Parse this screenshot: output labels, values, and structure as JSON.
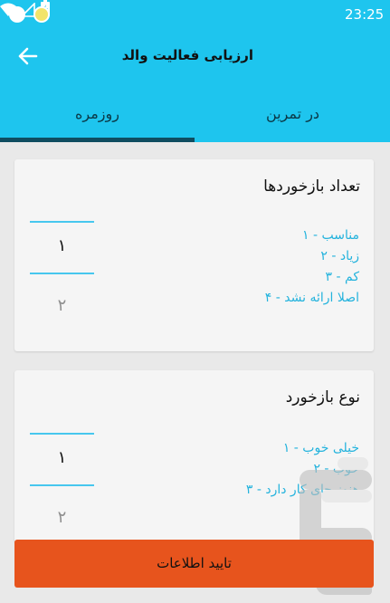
{
  "status_bar": {
    "time": "23:25",
    "icons": [
      "app-notification-icon",
      "app-notification-icon",
      "wifi-icon",
      "signal-icon",
      "battery-charging-icon"
    ]
  },
  "toolbar": {
    "title": "ارزیابی فعالیت والد",
    "back_icon": "back-arrow-icon"
  },
  "tabs": [
    {
      "label": "روزمره",
      "selected": true
    },
    {
      "label": "در تمرین",
      "selected": false
    }
  ],
  "cards": [
    {
      "title": "تعداد بازخوردها",
      "options": [
        "۱ - مناسب",
        "۲ - زیاد",
        "۳ - کم",
        "۴ - اصلا ارائه نشد"
      ],
      "picker": {
        "selected": "۱",
        "next": "۲"
      }
    },
    {
      "title": "نوع بازخورد",
      "options": [
        "۱ - خیلی خوب",
        "۲ - خوب",
        "۳ - هنوز جای کار دارد"
      ],
      "picker": {
        "selected": "۱",
        "next": "۲"
      }
    }
  ],
  "confirm_button": {
    "label": "تایید اطلاعات"
  },
  "colors": {
    "primary": "#1ec5ee",
    "accent_option": "#24b3dd",
    "button": "#e7541d",
    "tab_indicator": "#0f4d60"
  }
}
